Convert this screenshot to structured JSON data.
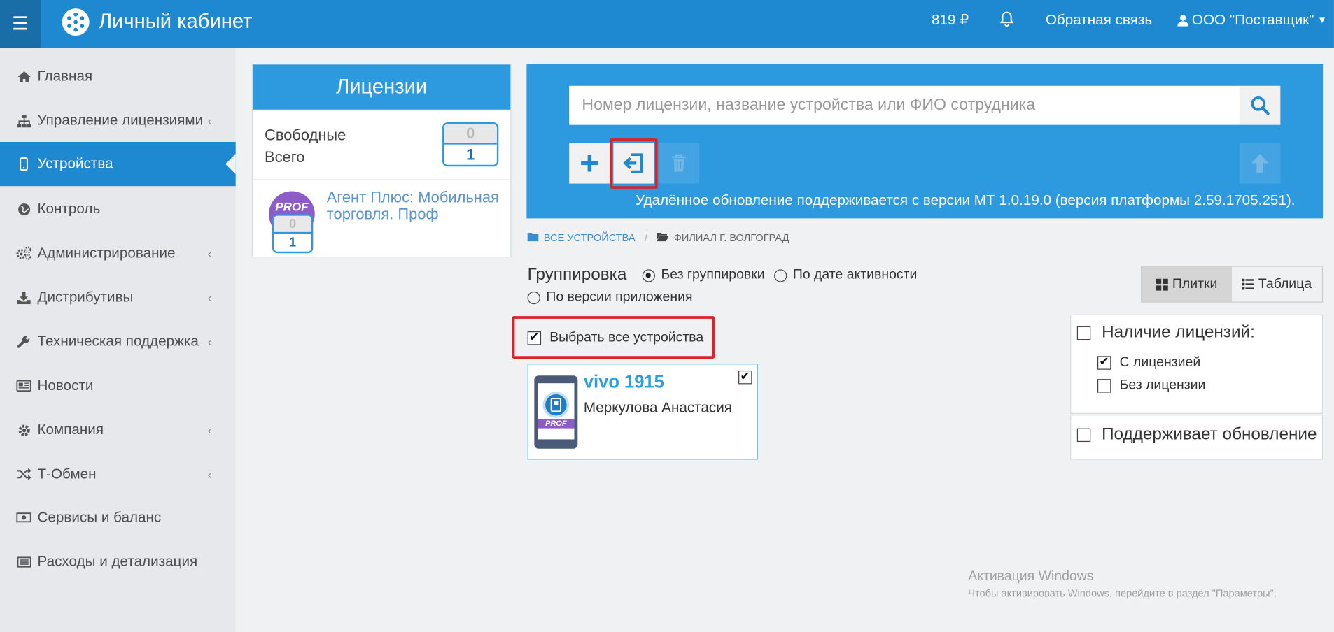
{
  "header": {
    "app_title": "Личный кабинет",
    "balance": "819 ₽",
    "feedback": "Обратная связь",
    "account": "ООО \"Поставщик\""
  },
  "sidebar": {
    "items": [
      {
        "label": "Главная",
        "icon": "home-icon"
      },
      {
        "label": "Управление лицензиями",
        "icon": "sitemap-icon"
      },
      {
        "label": "Устройства",
        "icon": "mobile-icon"
      },
      {
        "label": "Контроль",
        "icon": "globe-icon"
      },
      {
        "label": "Администрирование",
        "icon": "gears-icon"
      },
      {
        "label": "Дистрибутивы",
        "icon": "download-icon"
      },
      {
        "label": "Техническая поддержка",
        "icon": "wrench-icon"
      },
      {
        "label": "Новости",
        "icon": "newspaper-icon"
      },
      {
        "label": "Компания",
        "icon": "gear-icon"
      },
      {
        "label": "Т-Обмен",
        "icon": "shuffle-icon"
      },
      {
        "label": "Сервисы и баланс",
        "icon": "money-icon"
      },
      {
        "label": "Расходы и детализация",
        "icon": "list-icon"
      }
    ]
  },
  "licenses": {
    "title": "Лицензии",
    "free_label": "Свободные",
    "total_label": "Всего",
    "free_count": "0",
    "total_count": "1",
    "product_badge": "PROF",
    "product_name": "Агент Плюс: Мобильная торговля. Проф",
    "product_free": "0",
    "product_total": "1"
  },
  "search": {
    "placeholder": "Номер лицензии, название устройства или ФИО сотрудника",
    "update_note": "Удалённое обновление поддерживается с версии МТ 1.0.19.0 (версия платформы 2.59.1705.251)."
  },
  "breadcrumb": {
    "root": "ВСЕ УСТРОЙСТВА",
    "separator": "/",
    "current": "ФИЛИАЛ Г. ВОЛГОГРАД"
  },
  "grouping": {
    "label": "Группировка",
    "options": [
      "Без группировки",
      "По дате активности",
      "По версии приложения"
    ],
    "selected": "Без группировки"
  },
  "view": {
    "tiles": "Плитки",
    "table": "Таблица",
    "selected": "Плитки"
  },
  "select_all": "Выбрать все устройства",
  "device": {
    "name": "vivo 1915",
    "owner": "Меркулова Анастасия",
    "badge": "PROF",
    "checked": true
  },
  "filters": {
    "license_title": "Наличие лицензий:",
    "with_license": "С лицензией",
    "without_license": "Без лицензии",
    "supports_update": "Поддерживает обновление"
  },
  "watermark": {
    "title": "Активация Windows",
    "text": "Чтобы активировать Windows, перейдите в раздел \"Параметры\"."
  },
  "colors": {
    "brand_blue": "#1e88d0",
    "panel_blue": "#2d9ae0",
    "highlight_red": "#d9232a",
    "prof_purple": "#8e5cc7"
  }
}
